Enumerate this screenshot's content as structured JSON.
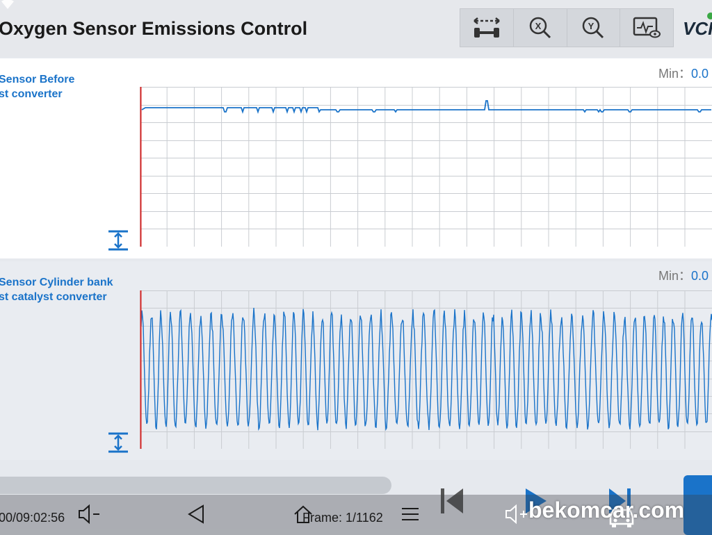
{
  "header": {
    "title": "Oxygen Sensor Emissions Control",
    "brand": "VCI",
    "tools": [
      {
        "name": "combine-graph-icon"
      },
      {
        "name": "x-axis-zoom-icon"
      },
      {
        "name": "y-axis-zoom-icon"
      },
      {
        "name": "monitor-view-icon"
      }
    ]
  },
  "panels": [
    {
      "title_line1": "Sensor Before",
      "title_line2": "st converter",
      "min_label": "Min：",
      "min_value": "0.0"
    },
    {
      "title_line1": "Sensor Cylinder bank",
      "title_line2": "st catalyst converter",
      "min_label": "Min：",
      "min_value": "0.0"
    }
  ],
  "playback": {
    "time": "00/09:02:56",
    "frame": "Frame: 1/1162",
    "progress": 0.55
  },
  "watermark": "bekomcar.com",
  "colors": {
    "accent": "#1a73c9",
    "cursor": "#d62828",
    "grid": "#c9ccd1"
  }
}
